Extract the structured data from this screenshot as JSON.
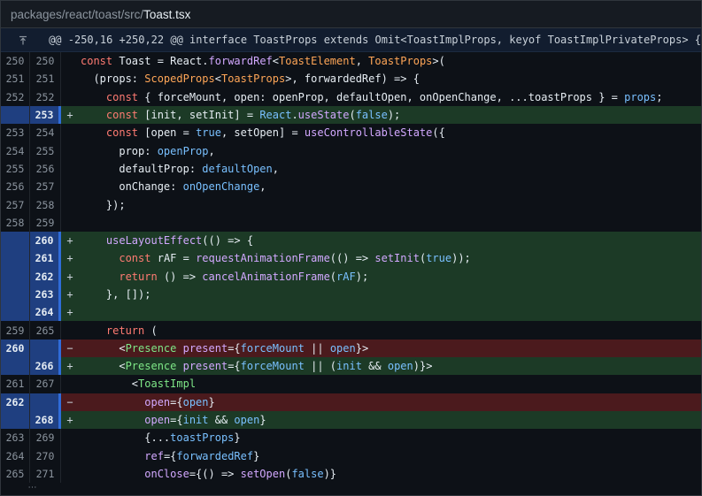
{
  "file_header": {
    "path_prefix": "packages/react/toast/src/",
    "file_name": "Toast.tsx"
  },
  "hunk": {
    "expand_icon": "arrow-up-to-line",
    "header_text": "@@ -250,16 +250,22 @@ interface ToastProps extends Omit<ToastImplProps, keyof ToastImplPrivateProps> {"
  },
  "colors": {
    "added_bg": "#1c3a26",
    "deleted_bg": "#4b1a1d",
    "selected_gutter": "#1f3f80",
    "keyword": "#ff7b72",
    "function": "#d2a8ff",
    "type": "#ffa657",
    "tag": "#7ee787",
    "constant": "#79c0ff"
  },
  "lines": [
    {
      "type": "ctx",
      "old": "250",
      "new": "250",
      "marker": "",
      "tokens": [
        [
          "kw",
          "const "
        ],
        [
          "txt",
          "Toast = React."
        ],
        [
          "fn",
          "forwardRef"
        ],
        [
          "txt",
          "<"
        ],
        [
          "ty",
          "ToastElement"
        ],
        [
          "txt",
          ", "
        ],
        [
          "ty",
          "ToastProps"
        ],
        [
          "txt",
          ">("
        ]
      ]
    },
    {
      "type": "ctx",
      "old": "251",
      "new": "251",
      "marker": "",
      "tokens": [
        [
          "txt",
          "  (props: "
        ],
        [
          "ty",
          "ScopedProps"
        ],
        [
          "txt",
          "<"
        ],
        [
          "ty",
          "ToastProps"
        ],
        [
          "txt",
          ">, forwardedRef) => {"
        ]
      ]
    },
    {
      "type": "ctx",
      "old": "252",
      "new": "252",
      "marker": "",
      "tokens": [
        [
          "txt",
          "    "
        ],
        [
          "kw",
          "const "
        ],
        [
          "txt",
          "{ forceMount, open: openProp, defaultOpen, onOpenChange, ...toastProps } = "
        ],
        [
          "cst",
          "props"
        ],
        [
          "txt",
          ";"
        ]
      ]
    },
    {
      "type": "add",
      "old": "",
      "new": "253",
      "marker": "+",
      "tokens": [
        [
          "txt",
          "    "
        ],
        [
          "kw",
          "const "
        ],
        [
          "txt",
          "[init, setInit] = "
        ],
        [
          "cst",
          "React"
        ],
        [
          "txt",
          "."
        ],
        [
          "fn",
          "useState"
        ],
        [
          "txt",
          "("
        ],
        [
          "cst",
          "false"
        ],
        [
          "txt",
          ");"
        ]
      ]
    },
    {
      "type": "ctx",
      "old": "253",
      "new": "254",
      "marker": "",
      "tokens": [
        [
          "txt",
          "    "
        ],
        [
          "kw",
          "const "
        ],
        [
          "txt",
          "[open = "
        ],
        [
          "cst",
          "true"
        ],
        [
          "txt",
          ", setOpen] = "
        ],
        [
          "fn",
          "useControllableState"
        ],
        [
          "txt",
          "({"
        ]
      ]
    },
    {
      "type": "ctx",
      "old": "254",
      "new": "255",
      "marker": "",
      "tokens": [
        [
          "txt",
          "      prop: "
        ],
        [
          "cst",
          "openProp"
        ],
        [
          "txt",
          ","
        ]
      ]
    },
    {
      "type": "ctx",
      "old": "255",
      "new": "256",
      "marker": "",
      "tokens": [
        [
          "txt",
          "      defaultProp: "
        ],
        [
          "cst",
          "defaultOpen"
        ],
        [
          "txt",
          ","
        ]
      ]
    },
    {
      "type": "ctx",
      "old": "256",
      "new": "257",
      "marker": "",
      "tokens": [
        [
          "txt",
          "      onChange: "
        ],
        [
          "cst",
          "onOpenChange"
        ],
        [
          "txt",
          ","
        ]
      ]
    },
    {
      "type": "ctx",
      "old": "257",
      "new": "258",
      "marker": "",
      "tokens": [
        [
          "txt",
          "    });"
        ]
      ]
    },
    {
      "type": "ctx",
      "old": "258",
      "new": "259",
      "marker": "",
      "tokens": []
    },
    {
      "type": "add",
      "old": "",
      "new": "260",
      "marker": "+",
      "tokens": [
        [
          "txt",
          "    "
        ],
        [
          "fn",
          "useLayoutEffect"
        ],
        [
          "txt",
          "(() => {"
        ]
      ]
    },
    {
      "type": "add",
      "old": "",
      "new": "261",
      "marker": "+",
      "tokens": [
        [
          "txt",
          "      "
        ],
        [
          "kw",
          "const "
        ],
        [
          "txt",
          "rAF = "
        ],
        [
          "fn",
          "requestAnimationFrame"
        ],
        [
          "txt",
          "(() => "
        ],
        [
          "fn",
          "setInit"
        ],
        [
          "txt",
          "("
        ],
        [
          "cst",
          "true"
        ],
        [
          "txt",
          "));"
        ]
      ]
    },
    {
      "type": "add",
      "old": "",
      "new": "262",
      "marker": "+",
      "tokens": [
        [
          "txt",
          "      "
        ],
        [
          "kw",
          "return "
        ],
        [
          "txt",
          "() => "
        ],
        [
          "fn",
          "cancelAnimationFrame"
        ],
        [
          "txt",
          "("
        ],
        [
          "cst",
          "rAF"
        ],
        [
          "txt",
          ");"
        ]
      ]
    },
    {
      "type": "add",
      "old": "",
      "new": "263",
      "marker": "+",
      "tokens": [
        [
          "txt",
          "    }, []);"
        ]
      ]
    },
    {
      "type": "add",
      "old": "",
      "new": "264",
      "marker": "+",
      "tokens": []
    },
    {
      "type": "ctx",
      "old": "259",
      "new": "265",
      "marker": "",
      "tokens": [
        [
          "txt",
          "    "
        ],
        [
          "kw",
          "return "
        ],
        [
          "txt",
          "("
        ]
      ]
    },
    {
      "type": "del",
      "old": "260",
      "new": "",
      "marker": "−",
      "tokens": [
        [
          "txt",
          "      <"
        ],
        [
          "tg",
          "Presence "
        ],
        [
          "fn",
          "present"
        ],
        [
          "txt",
          "={"
        ],
        [
          "cst",
          "forceMount "
        ],
        [
          "txt",
          "|| "
        ],
        [
          "cst",
          "open"
        ],
        [
          "txt",
          "}>"
        ]
      ]
    },
    {
      "type": "add",
      "old": "",
      "new": "266",
      "marker": "+",
      "tokens": [
        [
          "txt",
          "      <"
        ],
        [
          "tg",
          "Presence "
        ],
        [
          "fn",
          "present"
        ],
        [
          "txt",
          "={"
        ],
        [
          "cst",
          "forceMount "
        ],
        [
          "txt",
          "|| ("
        ],
        [
          "cst",
          "init "
        ],
        [
          "txt",
          "&& "
        ],
        [
          "cst",
          "open"
        ],
        [
          "txt",
          ")}>"
        ]
      ]
    },
    {
      "type": "ctx",
      "old": "261",
      "new": "267",
      "marker": "",
      "tokens": [
        [
          "txt",
          "        <"
        ],
        [
          "tg",
          "ToastImpl"
        ]
      ]
    },
    {
      "type": "del",
      "old": "262",
      "new": "",
      "marker": "−",
      "tokens": [
        [
          "txt",
          "          "
        ],
        [
          "fn",
          "open"
        ],
        [
          "txt",
          "={"
        ],
        [
          "cst",
          "open"
        ],
        [
          "txt",
          "}"
        ]
      ]
    },
    {
      "type": "add",
      "old": "",
      "new": "268",
      "marker": "+",
      "tokens": [
        [
          "txt",
          "          "
        ],
        [
          "fn",
          "open"
        ],
        [
          "txt",
          "={"
        ],
        [
          "cst",
          "init "
        ],
        [
          "txt",
          "&& "
        ],
        [
          "cst",
          "open"
        ],
        [
          "txt",
          "}"
        ]
      ]
    },
    {
      "type": "ctx",
      "old": "263",
      "new": "269",
      "marker": "",
      "tokens": [
        [
          "txt",
          "          {..."
        ],
        [
          "cst",
          "toastProps"
        ],
        [
          "txt",
          "}"
        ]
      ]
    },
    {
      "type": "ctx",
      "old": "264",
      "new": "270",
      "marker": "",
      "tokens": [
        [
          "txt",
          "          "
        ],
        [
          "fn",
          "ref"
        ],
        [
          "txt",
          "={"
        ],
        [
          "cst",
          "forwardedRef"
        ],
        [
          "txt",
          "}"
        ]
      ]
    },
    {
      "type": "ctx",
      "old": "265",
      "new": "271",
      "marker": "",
      "tokens": [
        [
          "txt",
          "          "
        ],
        [
          "fn",
          "onClose"
        ],
        [
          "txt",
          "={() => "
        ],
        [
          "fn",
          "setOpen"
        ],
        [
          "txt",
          "("
        ],
        [
          "cst",
          "false"
        ],
        [
          "txt",
          ")}"
        ]
      ]
    }
  ]
}
